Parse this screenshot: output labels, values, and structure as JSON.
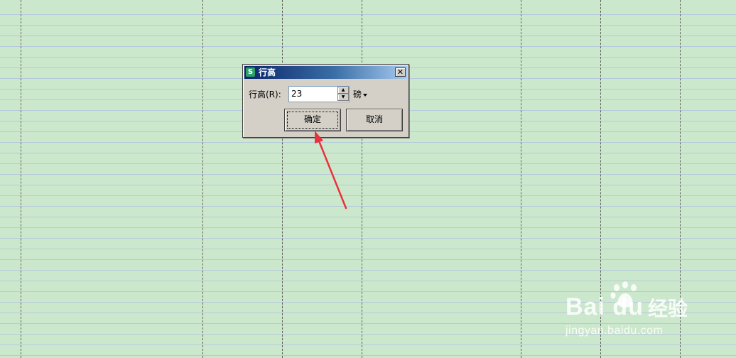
{
  "dialog": {
    "title": "行高",
    "app_icon_letter": "S",
    "close_glyph": "✕",
    "field_label": "行高(R):",
    "field_value": "23",
    "unit_label": "磅",
    "ok_label": "确定",
    "cancel_label": "取消"
  },
  "watermark": {
    "logo_text": "Bai  du",
    "brand_cn": "经验",
    "url": "jingyan.baidu.com"
  },
  "colors": {
    "sheet_background": "#cce8cc",
    "annotation_arrow": "#e8323c"
  }
}
